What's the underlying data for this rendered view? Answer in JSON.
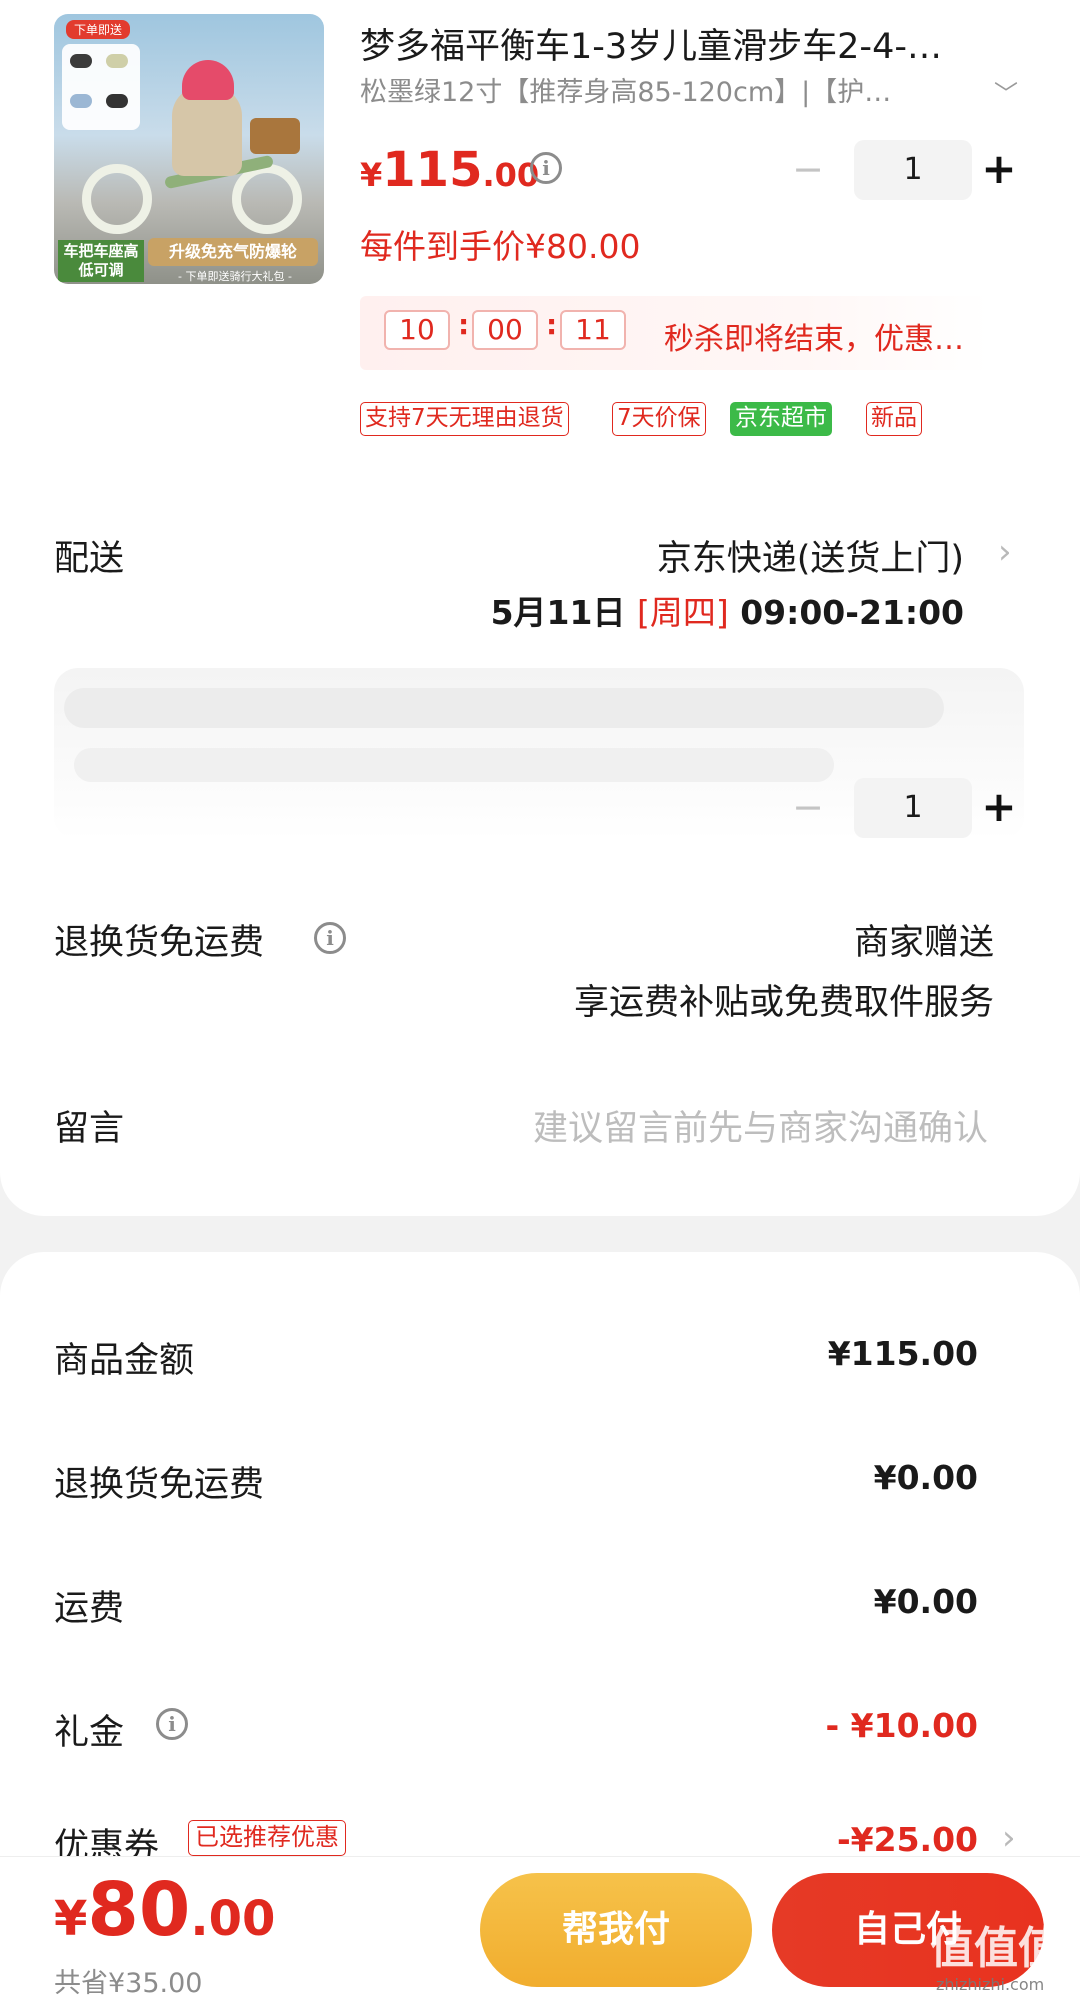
{
  "product": {
    "title": "梦多福平衡车1-3岁儿童滑步车2-4-…",
    "spec": "松墨绿12寸【推荐身高85-120cm】|【护…",
    "price_currency": "¥",
    "price_int": "115",
    "price_dec": ".00",
    "quantity": "1",
    "final_price": "每件到手价¥80.00",
    "image_texts": {
      "badge": "下单即送",
      "left": "车把车座高低可调",
      "right": "升级免充气防爆轮",
      "sub": "- 下单即送骑行大礼包 -"
    }
  },
  "countdown": {
    "hours": "10",
    "minutes": "00",
    "seconds": "11",
    "text": "秒杀即将结束，优惠…"
  },
  "tags": [
    "支持7天无理由退货",
    "7天价保",
    "京东超市",
    "新品"
  ],
  "delivery": {
    "label": "配送",
    "method": "京东快递(送货上门)",
    "date": "5月11日",
    "weekday": "[周四]",
    "time": "09:00-21:00"
  },
  "second_item": {
    "quantity": "1"
  },
  "return_shipping": {
    "label": "退换货免运费",
    "value": "商家赠送",
    "desc": "享运费补贴或免费取件服务"
  },
  "message": {
    "label": "留言",
    "placeholder": "建议留言前先与商家沟通确认"
  },
  "summary": [
    {
      "label": "商品金额",
      "value": "¥115.00"
    },
    {
      "label": "退换货免运费",
      "value": "¥0.00"
    },
    {
      "label": "运费",
      "value": "¥0.00"
    },
    {
      "label": "礼金",
      "value": "- ¥10.00"
    },
    {
      "label": "优惠券",
      "value": "-¥25.00"
    }
  ],
  "coupon_tag": "已选推荐优惠",
  "bottom_bar": {
    "total_currency": "¥",
    "total_int": "80",
    "total_dec": ".00",
    "saved": "共省¥35.00",
    "help_pay": "帮我付",
    "self_pay": "自己付"
  },
  "watermark": {
    "main": "值值值",
    "sub": "zhizhizhi.com"
  },
  "colors": {
    "accent_red": "#e0291f",
    "help_yellow": "#f3b53a",
    "green_tag": "#3cba48"
  },
  "icons": [
    "info-icon",
    "chevron-down-icon",
    "chevron-right-icon",
    "minus-icon",
    "plus-icon"
  ]
}
